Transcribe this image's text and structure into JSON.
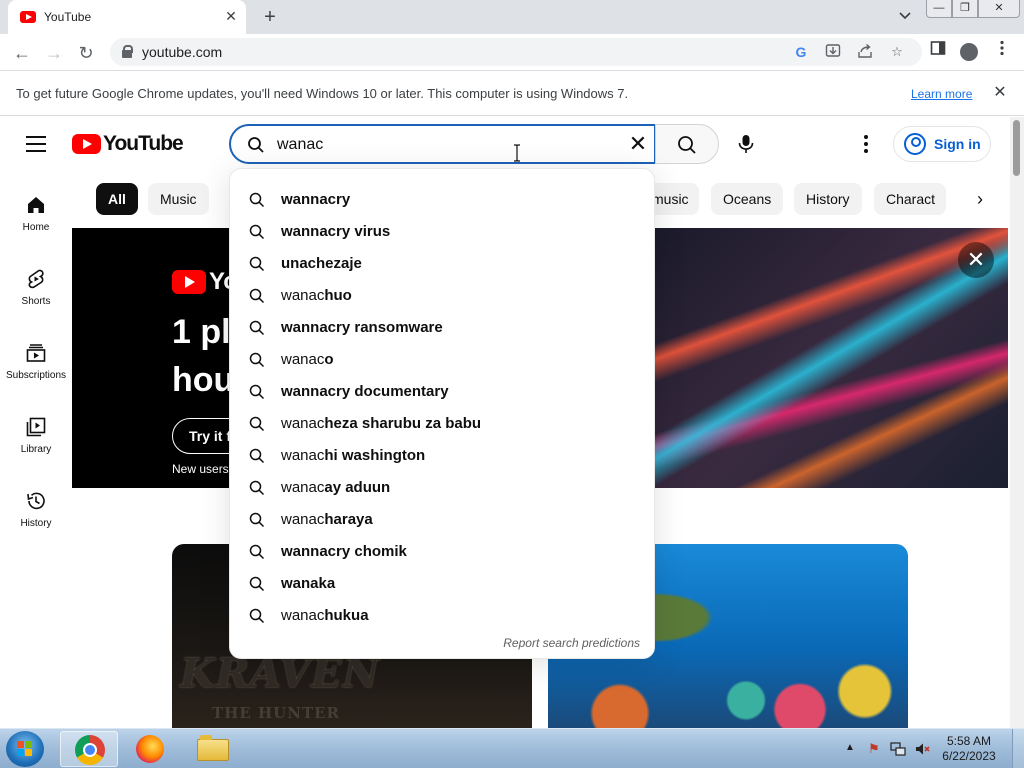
{
  "browser": {
    "tab_title": "YouTube",
    "tab_close": "✕",
    "new_tab": "+",
    "url": "youtube.com",
    "back_icon": "←",
    "forward_icon": "→",
    "reload_icon": "↻",
    "window_min": "—",
    "window_restore": "❐",
    "window_close": "✕"
  },
  "infobar": {
    "message": "To get future Google Chrome updates, you'll need Windows 10 or later. This computer is using Windows 7.",
    "link": "Learn more",
    "close": "✕"
  },
  "header": {
    "logo_text": "YouTube",
    "search_value": "wanac",
    "clear": "✕",
    "sign_in": "Sign in"
  },
  "rail": [
    {
      "label": "Home",
      "icon": "home-icon"
    },
    {
      "label": "Shorts",
      "icon": "shorts-icon"
    },
    {
      "label": "Subscriptions",
      "icon": "subscriptions-icon"
    },
    {
      "label": "Library",
      "icon": "library-icon"
    },
    {
      "label": "History",
      "icon": "history-icon"
    }
  ],
  "chips": [
    "All",
    "Music",
    "music",
    "Oceans",
    "History",
    "Charact"
  ],
  "chip_next": "›",
  "banner": {
    "logo_text": "Yo",
    "headline_1": "1 pl",
    "headline_2": "hou",
    "cta": "Try it f",
    "note": "New users",
    "close": "✕"
  },
  "suggestions": [
    {
      "typed": "",
      "rest": "wannacry"
    },
    {
      "typed": "",
      "rest": "wannacry virus"
    },
    {
      "typed": "",
      "rest": "unachezaje"
    },
    {
      "typed": "wanac",
      "rest": "huo"
    },
    {
      "typed": "",
      "rest": "wannacry ransomware"
    },
    {
      "typed": "wanac",
      "rest": "o"
    },
    {
      "typed": "",
      "rest": "wannacry documentary"
    },
    {
      "typed": "wanac",
      "rest": "heza sharubu za babu"
    },
    {
      "typed": "wanac",
      "rest": "hi washington"
    },
    {
      "typed": "wanac",
      "rest": "ay aduun"
    },
    {
      "typed": "wanac",
      "rest": "haraya"
    },
    {
      "typed": "",
      "rest": "wannacry chomik"
    },
    {
      "typed": "",
      "rest": "wanaka"
    },
    {
      "typed": "wanac",
      "rest": "hukua"
    }
  ],
  "report_link": "Report search predictions",
  "thumbnails": {
    "left_title": "KRAVEN",
    "left_subtitle": "THE HUNTER"
  },
  "taskbar": {
    "time": "5:58 AM",
    "date": "6/22/2023",
    "tray_arrow": "▲"
  },
  "colors": {
    "youtube_red": "#ff0000",
    "link_blue": "#065fd4",
    "search_focus": "#1c62b9"
  }
}
